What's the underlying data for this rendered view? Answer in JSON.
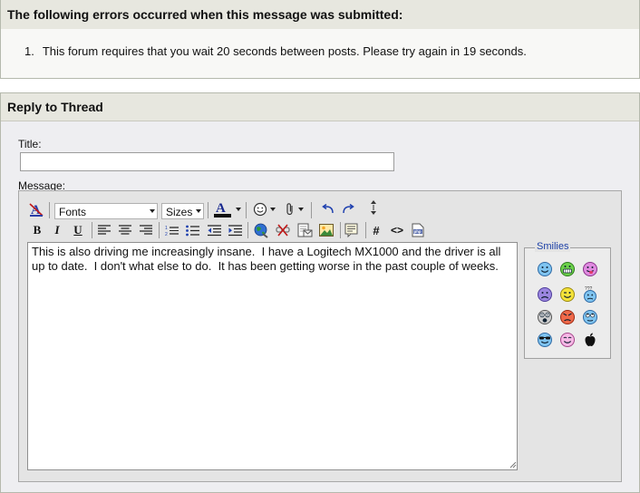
{
  "errors": {
    "heading": "The following errors occurred when this message was submitted:",
    "items": [
      {
        "num": "1.",
        "text": "This forum requires that you wait 20 seconds between posts. Please try again in 19 seconds."
      }
    ]
  },
  "reply": {
    "heading": "Reply to Thread",
    "title_label": "Title:",
    "title_value": "",
    "message_label": "Message:",
    "message_value": "This is also driving me increasingly insane.  I have a Logitech MX1000 and the driver is all up to date.  I don't what else to do.  It has been getting worse in the past couple of weeks.",
    "toolbar": {
      "fonts": "Fonts",
      "sizes": "Sizes",
      "bold": "B",
      "italic": "I",
      "underline": "U",
      "hash": "#",
      "code": "<>"
    },
    "smilies_label": "Smilies"
  },
  "colors": {
    "link_blue": "#1b3fa6",
    "panel_header": "#e7e7df",
    "panel_border": "#b5b9ad"
  }
}
